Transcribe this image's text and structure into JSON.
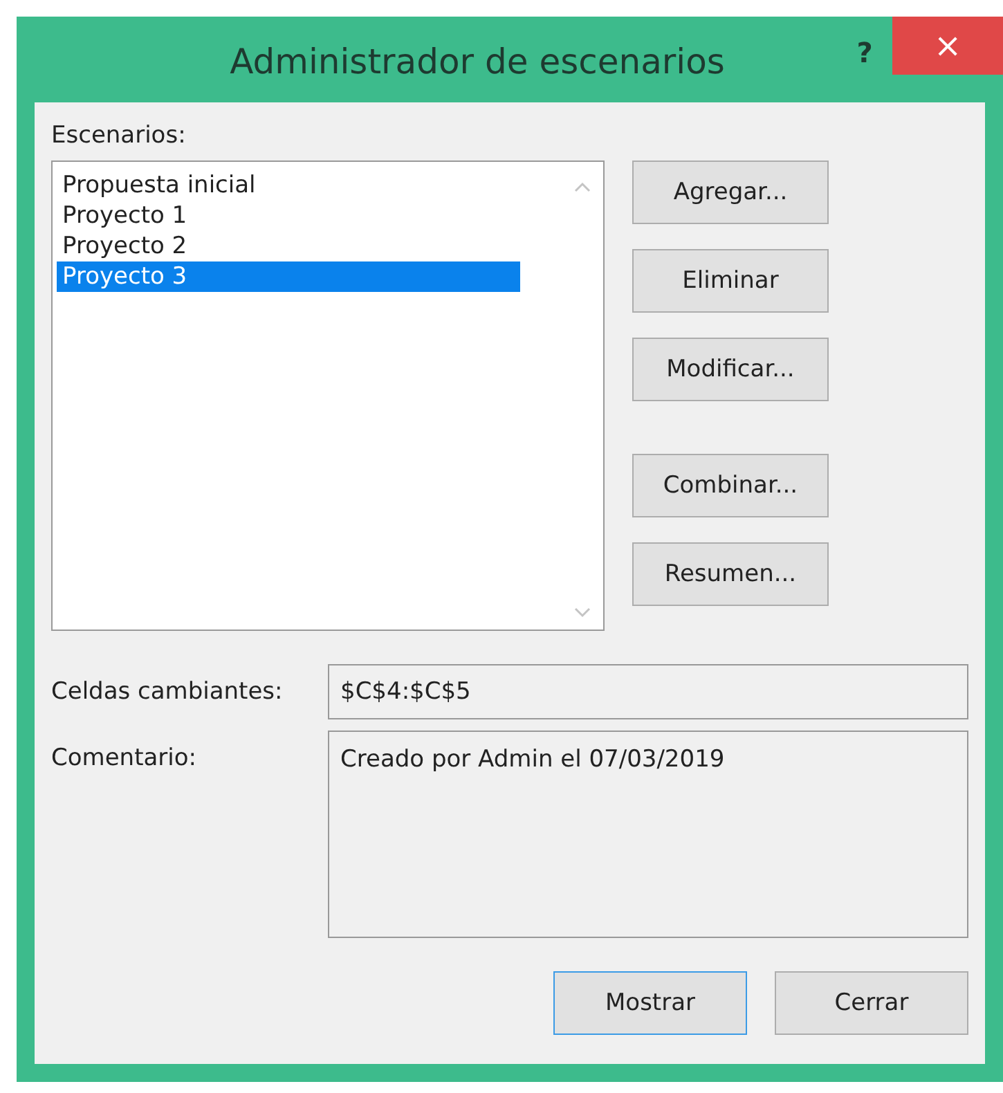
{
  "window": {
    "title": "Administrador de escenarios",
    "help": "?",
    "close": "×"
  },
  "scenarios": {
    "label": "Escenarios:",
    "items": [
      {
        "name": "Propuesta inicial",
        "selected": false
      },
      {
        "name": "Proyecto 1",
        "selected": false
      },
      {
        "name": "Proyecto 2",
        "selected": false
      },
      {
        "name": "Proyecto 3",
        "selected": true
      }
    ]
  },
  "side_buttons": [
    {
      "label": "Agregar..."
    },
    {
      "label": "Eliminar"
    },
    {
      "label": "Modificar..."
    },
    {
      "label": "Combinar..."
    },
    {
      "label": "Resumen..."
    }
  ],
  "changing_cells": {
    "label": "Celdas cambiantes:",
    "value": "$C$4:$C$5"
  },
  "comment": {
    "label": "Comentario:",
    "value": "Creado por Admin el 07/03/2019"
  },
  "buttons": [
    {
      "label": "Mostrar",
      "default": true
    },
    {
      "label": "Cerrar",
      "default": false
    }
  ]
}
